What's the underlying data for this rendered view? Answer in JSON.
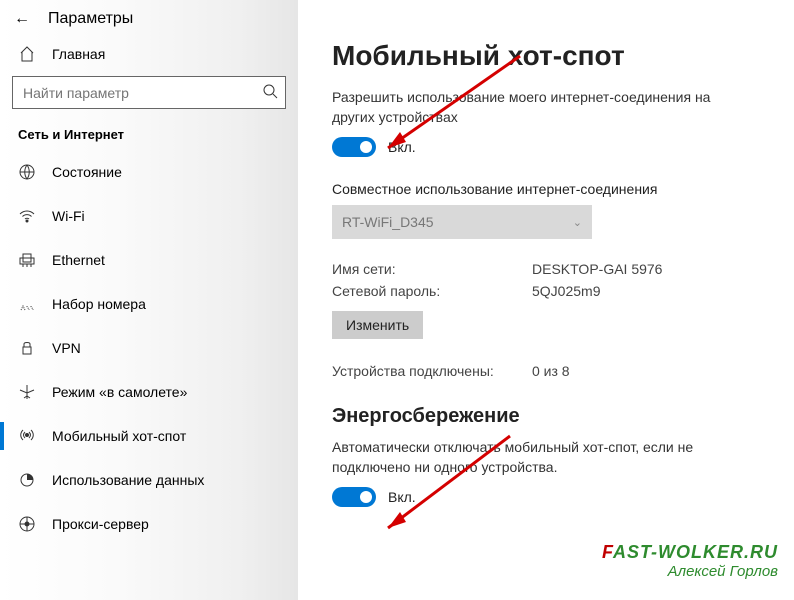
{
  "header": {
    "title": "Параметры",
    "home_label": "Главная",
    "search_placeholder": "Найти параметр",
    "section_label": "Сеть и Интернет"
  },
  "sidebar": {
    "items": [
      {
        "label": "Состояние"
      },
      {
        "label": "Wi-Fi"
      },
      {
        "label": "Ethernet"
      },
      {
        "label": "Набор номера"
      },
      {
        "label": "VPN"
      },
      {
        "label": "Режим «в самолете»"
      },
      {
        "label": "Мобильный хот-спот"
      },
      {
        "label": "Использование данных"
      },
      {
        "label": "Прокси-сервер"
      }
    ]
  },
  "main": {
    "title": "Мобильный хот-спот",
    "share_desc": "Разрешить использование моего интернет-соединения на других устройствах",
    "toggle1_state": "Вкл.",
    "share_conn_label": "Совместное использование интернет-соединения",
    "share_conn_value": "RT-WiFi_D345",
    "net_name_label": "Имя сети:",
    "net_name_value": "DESKTOP-GAI 5976",
    "net_pass_label": "Сетевой пароль:",
    "net_pass_value": "5QJ025m9",
    "edit_btn": "Изменить",
    "devices_label": "Устройства подключены:",
    "devices_value": "0 из 8",
    "power_title": "Энергосбережение",
    "power_desc": "Автоматически отключать мобильный хот-спот, если не подключено ни одного устройства.",
    "toggle2_state": "Вкл."
  },
  "watermark": {
    "line1_f": "F",
    "line1_rest": "AST-WOLKER.RU",
    "line2": "Алексей Горлов"
  }
}
